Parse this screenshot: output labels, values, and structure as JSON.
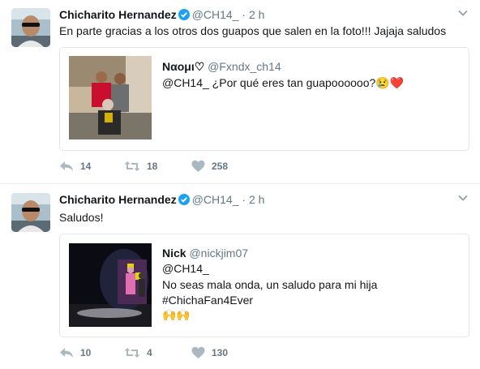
{
  "tweets": [
    {
      "author_name": "Chicharito Hernandez",
      "author_handle": "@CH14_",
      "time": "· 2 h",
      "text": "En parte gracias a los otros dos guapos que salen en la foto!!! Jajaja saludos",
      "quote": {
        "name": "Ναομι♡",
        "handle": "@Fxndx_ch14",
        "lines": [
          "@CH14_ ¿Por qué eres tan guapoooooo?😢❤️"
        ]
      },
      "actions": {
        "reply": "14",
        "retweet": "18",
        "like": "258"
      }
    },
    {
      "author_name": "Chicharito Hernandez",
      "author_handle": "@CH14_",
      "time": "· 2 h",
      "text": "Saludos!",
      "quote": {
        "name": "Nick",
        "handle": "@nickjim07",
        "lines": [
          "@CH14_",
          "No seas mala onda,  un saludo para mi hija",
          "#ChichaFan4Ever",
          "🙌🙌"
        ]
      },
      "actions": {
        "reply": "10",
        "retweet": "4",
        "like": "130"
      }
    }
  ],
  "colors": {
    "verified": "#1da1f2",
    "meta_gray": "#657786",
    "border": "#e1e8ed"
  },
  "icons": [
    "verified-badge-icon",
    "chevron-down-icon",
    "reply-icon",
    "retweet-icon",
    "heart-icon"
  ]
}
